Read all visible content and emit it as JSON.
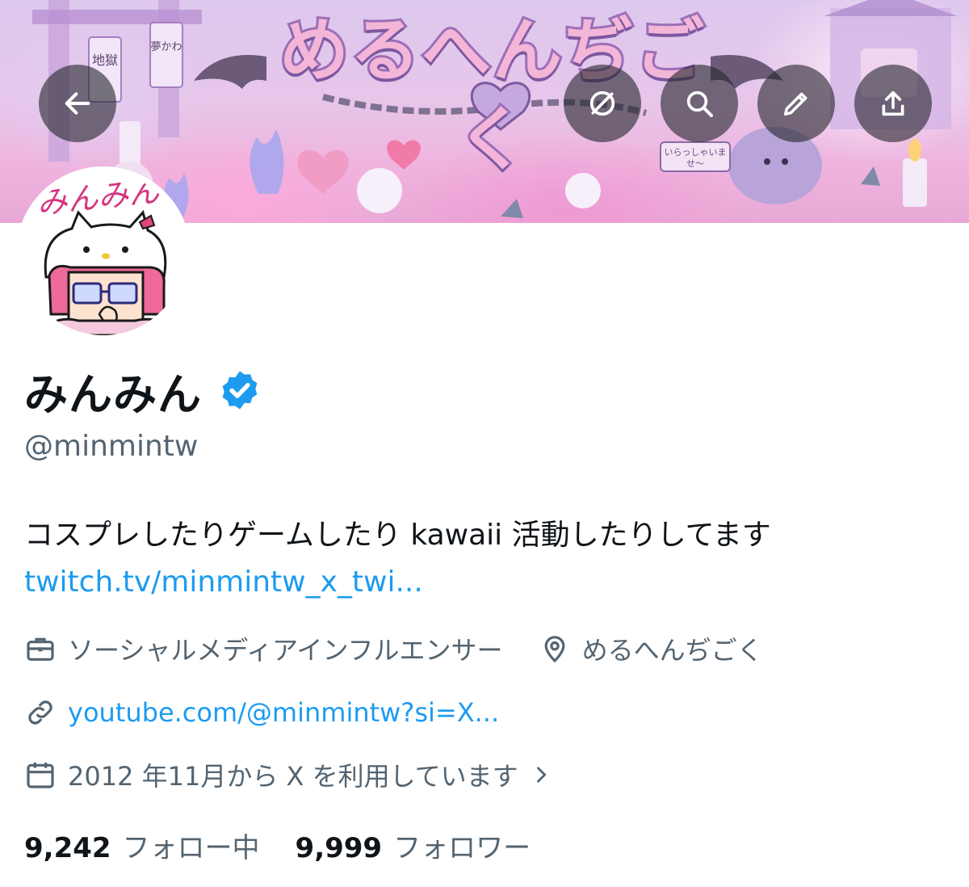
{
  "banner": {
    "title": "めるへんぢごく",
    "shrine_left": "地獄",
    "shrine_right": "夢かわ",
    "sign": "いらっしゃいま せ〜"
  },
  "toolbar": {
    "back_icon": "arrow-left-icon",
    "hide_icon": "eye-slash-circle-icon",
    "search_icon": "search-icon",
    "edit_icon": "pencil-icon",
    "share_icon": "share-icon"
  },
  "avatar": {
    "signature": "みんみん"
  },
  "profile": {
    "name": "みんみん",
    "verified_icon": "verified-badge-icon",
    "handle": "@minmintw",
    "bio": "コスプレしたりゲームしたり kawaii 活動したりしてます",
    "bio_link": "twitch.tv/minmintw_x_twi..."
  },
  "meta": {
    "category": "ソーシャルメディアインフルエンサー",
    "location": "めるへんぢごく",
    "website": "youtube.com/@minmintw?si=X...",
    "joined": "2012 年11月から X を利用しています"
  },
  "stats": {
    "following_count": "9,242",
    "following_label": "フォロー中",
    "followers_count": "9,999",
    "followers_label": "フォロワー"
  },
  "colors": {
    "accent": "#1d9bf0",
    "secondary_text": "#536471",
    "primary_text": "#0f1419",
    "banner_pink": "#efb3de",
    "banner_lavender": "#ddc8ee"
  }
}
